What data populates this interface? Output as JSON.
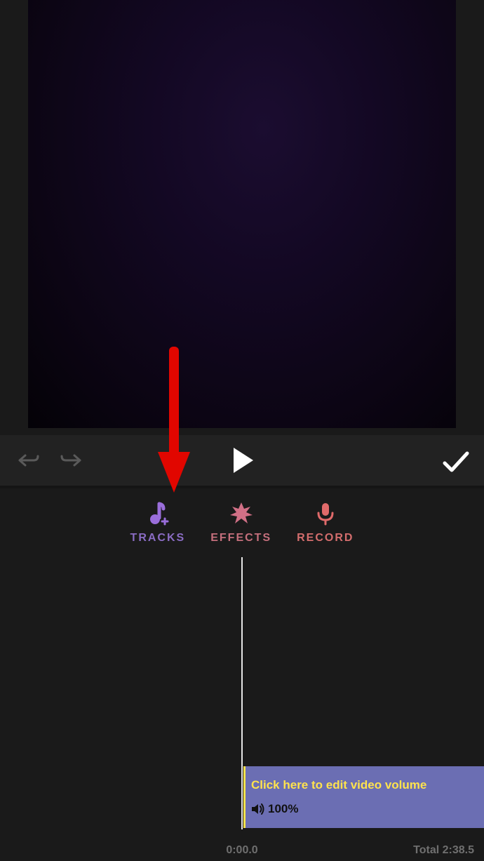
{
  "tabs": {
    "tracks": "TRACKS",
    "effects": "EFFECTS",
    "record": "RECORD"
  },
  "volume": {
    "hint": "Click here to edit video volume",
    "percent": "100%"
  },
  "time": {
    "current": "0:00.0",
    "total_label": "Total 2:38.5"
  },
  "colors": {
    "tracks": "#9a6edb",
    "effects": "#d17086",
    "record": "#e06a6a",
    "arrow": "#e10600",
    "volume_bar": "#6b6eb3",
    "volume_accent": "#ffe34d"
  }
}
